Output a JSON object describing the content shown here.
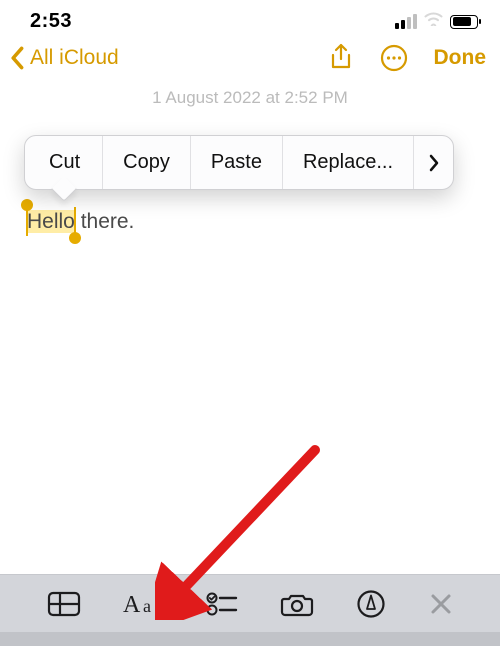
{
  "status": {
    "time": "2:53"
  },
  "nav": {
    "back_label": "All iCloud",
    "done_label": "Done"
  },
  "faded_date": "1 August 2022 at 2:52 PM",
  "context_menu": {
    "cut": "Cut",
    "copy": "Copy",
    "paste": "Paste",
    "replace": "Replace..."
  },
  "note": {
    "selected_text": "Hello",
    "rest_text": " there."
  }
}
